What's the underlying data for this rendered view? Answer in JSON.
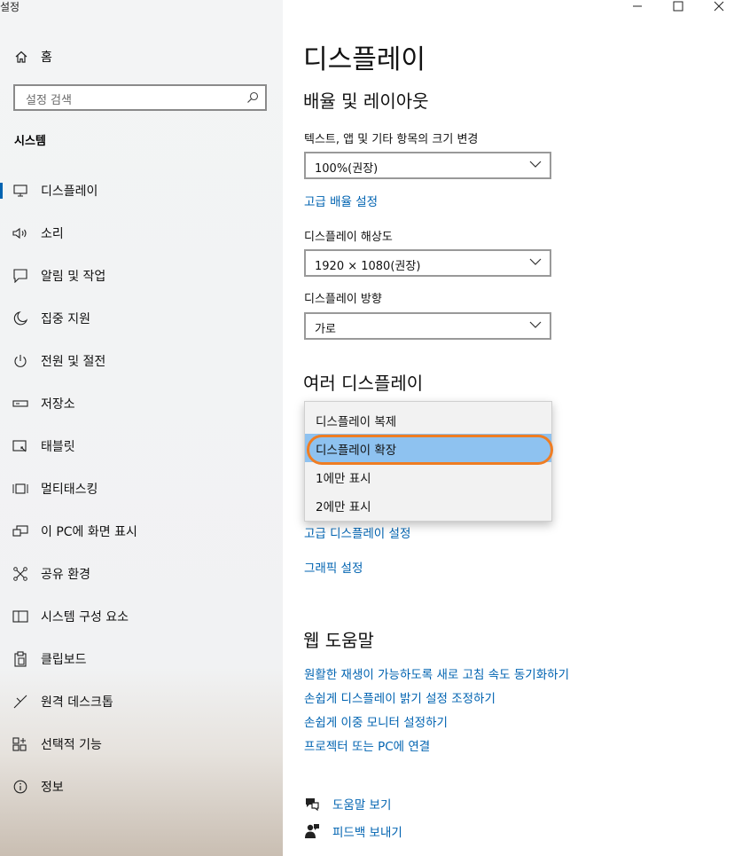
{
  "window": {
    "title": "설정",
    "minimize": "—",
    "maximize": "☐",
    "close": "✕"
  },
  "sidebar": {
    "home": "홈",
    "search_placeholder": "설정 검색",
    "section": "시스템",
    "items": [
      {
        "label": "디스플레이",
        "icon": "monitor-icon"
      },
      {
        "label": "소리",
        "icon": "speaker-icon"
      },
      {
        "label": "알림 및 작업",
        "icon": "notification-icon"
      },
      {
        "label": "집중 지원",
        "icon": "moon-icon"
      },
      {
        "label": "전원 및 절전",
        "icon": "power-icon"
      },
      {
        "label": "저장소",
        "icon": "storage-icon"
      },
      {
        "label": "태블릿",
        "icon": "tablet-icon"
      },
      {
        "label": "멀티태스킹",
        "icon": "multitasking-icon"
      },
      {
        "label": "이 PC에 화면 표시",
        "icon": "project-icon"
      },
      {
        "label": "공유 환경",
        "icon": "share-icon"
      },
      {
        "label": "시스템 구성 요소",
        "icon": "components-icon"
      },
      {
        "label": "클립보드",
        "icon": "clipboard-icon"
      },
      {
        "label": "원격 데스크톱",
        "icon": "remote-icon"
      },
      {
        "label": "선택적 기능",
        "icon": "features-icon"
      },
      {
        "label": "정보",
        "icon": "info-icon"
      }
    ]
  },
  "main": {
    "title": "디스플레이",
    "scale_section": "배율 및 레이아웃",
    "scale_label": "텍스트, 앱 및 기타 항목의 크기 변경",
    "scale_value": "100%(권장)",
    "advanced_scale_link": "고급 배율 설정",
    "resolution_label": "디스플레이 해상도",
    "resolution_value": "1920 × 1080(권장)",
    "orientation_label": "디스플레이 방향",
    "orientation_value": "가로",
    "multi_section": "여러 디스플레이",
    "multi_options": [
      "디스플레이 복제",
      "디스플레이 확장",
      "1에만 표시",
      "2에만 표시"
    ],
    "multi_selected": "디스플레이 확장",
    "advanced_display_link": "고급 디스플레이 설정",
    "graphics_link": "그래픽 설정",
    "web_help_section": "웹 도움말",
    "help_links": [
      "원활한 재생이 가능하도록 새로 고침 속도 동기화하기",
      "손쉽게 디스플레이 밝기 설정 조정하기",
      "손쉽게 이중 모니터 설정하기",
      "프로젝터 또는 PC에 연결"
    ],
    "get_help": "도움말 보기",
    "feedback": "피드백 보내기"
  },
  "colors": {
    "accent": "#0063b1",
    "selected_option": "#8ec2f0",
    "highlight_ring": "#ef7d23"
  }
}
